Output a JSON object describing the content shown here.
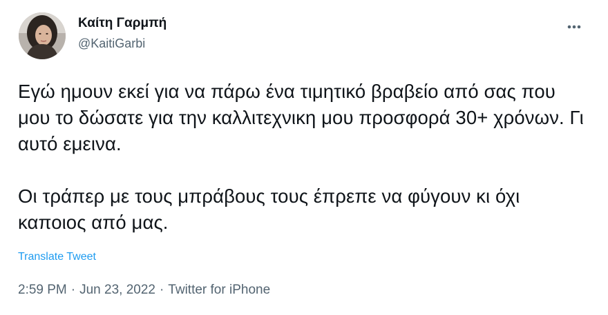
{
  "tweet": {
    "author": {
      "display_name": "Καίτη Γαρμπή",
      "handle": "@KaitiGarbi",
      "avatar": "profile-photo"
    },
    "more_icon": "more-horizontal-icon",
    "text": "Εγώ ημουν εκεί για να πάρω ένα τιμητικό βραβείο από σας που μου το δώσατε για την καλλιτεχνικη μου προσφορά 30+ χρόνων. Γι αυτό εμεινα.\n\nΟι τράπερ με τους μπράβους τους έπρεπε να φύγουν κι όχι καποιος από μας.",
    "translate_label": "Translate Tweet",
    "time": "2:59 PM",
    "date": "Jun 23, 2022",
    "source": "Twitter for iPhone",
    "separator": "·"
  },
  "colors": {
    "text": "#0f1419",
    "secondary": "#536471",
    "link": "#1d9bf0",
    "background": "#ffffff"
  }
}
